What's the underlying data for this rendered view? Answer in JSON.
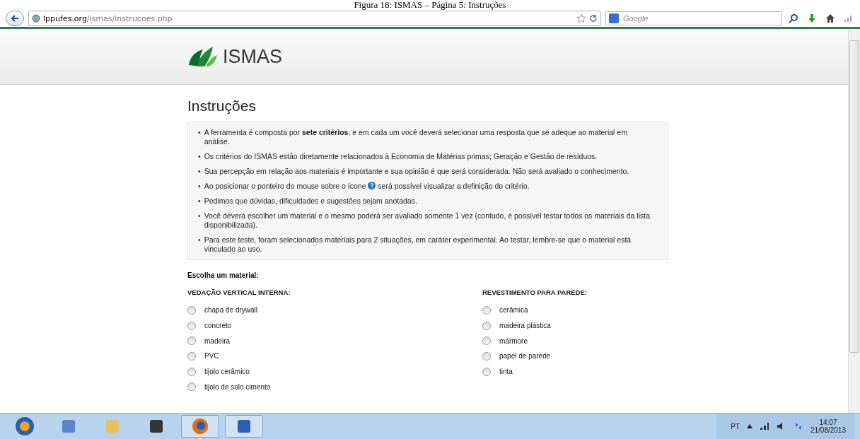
{
  "caption": "Figura 18: ISMAS – Página 5: Instruções",
  "browser": {
    "url_domain": "lppufes.org",
    "url_path": "/ismas/instrucoes.php",
    "search": {
      "placeholder": "Google"
    }
  },
  "site": {
    "logo_text": "ISMAS"
  },
  "page": {
    "title": "Instruções",
    "bullet": "•",
    "instructions": [
      {
        "kind": "text",
        "text": "A ferramenta é composta por **sete critérios**, e em cada um você deverá selecionar uma resposta que se adeque ao material em análise."
      },
      {
        "kind": "text",
        "text": "Os critérios do ISMAS estão diretamente relacionados à Economia de Matérias primas; Geração e Gestão de resíduos."
      },
      {
        "kind": "text",
        "text": "Sua percepção em relação aos materiais é importante e sua opinião é que será considerada. Não será avaliado o conhecimento."
      },
      {
        "kind": "with_icon",
        "before": "Ao posicionar o ponteiro do mouse sobre o ícone",
        "after": "será possível visualizar a definição do critério."
      },
      {
        "kind": "text",
        "text": "Pedimos que dúvidas, dificuldades e sugestões sejam anotadas."
      },
      {
        "kind": "text",
        "text": "Você deverá escolher um material e o mesmo poderá ser avaliado somente 1 vez (contudo, é possível testar todos os materiais da lista disponibilizada)."
      },
      {
        "kind": "text",
        "text": "Para este teste, foram selecionados materiais para 2 situações, em caráter experimental. Ao testar, lembre-se que o material está vinculado ao uso."
      }
    ],
    "choose_label": "Escolha um material:",
    "groups": [
      {
        "heading": "VEDAÇÃO VERTICAL INTERNA:",
        "options": [
          {
            "label": "chapa de drywall",
            "selected": false
          },
          {
            "label": "concreto",
            "selected": false
          },
          {
            "label": "madeira",
            "selected": false
          },
          {
            "label": "PVC",
            "selected": false
          },
          {
            "label": "tijolo cerâmico",
            "selected": false
          },
          {
            "label": "tijolo de solo cimento",
            "selected": false
          }
        ]
      },
      {
        "heading": "REVESTIMENTO PARA PAREDE:",
        "options": [
          {
            "label": "cerâmica",
            "selected": false
          },
          {
            "label": "madeira plástica",
            "selected": false
          },
          {
            "label": "mármore",
            "selected": false
          },
          {
            "label": "papel de parede",
            "selected": false
          },
          {
            "label": "tinta",
            "selected": false
          }
        ]
      }
    ]
  },
  "taskbar": {
    "language": "PT",
    "time": "14:07",
    "date": "21/08/2013"
  }
}
